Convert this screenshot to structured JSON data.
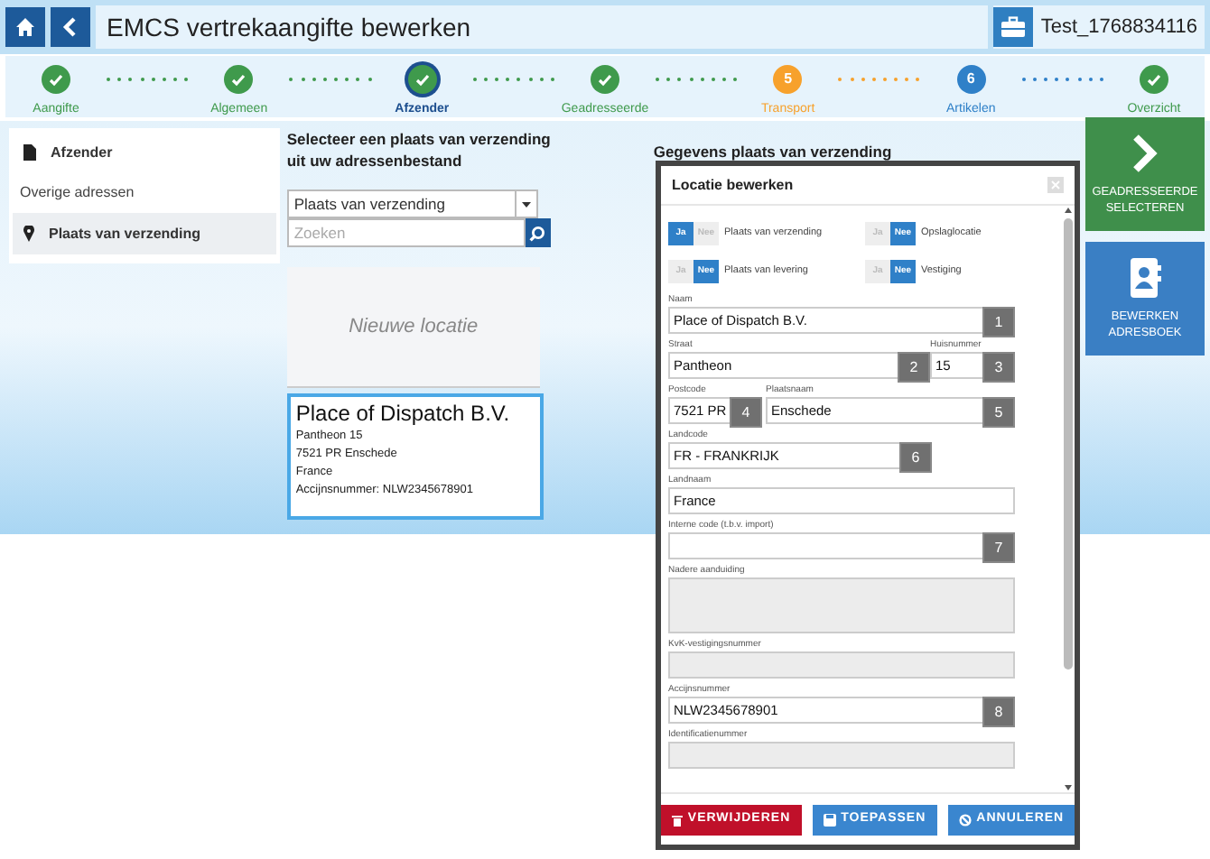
{
  "header": {
    "title": "EMCS vertrekaangifte bewerken",
    "user": "Test_1768834116"
  },
  "steps": [
    {
      "label": "Aangifte",
      "kind": "done",
      "selected": false
    },
    {
      "label": "Algemeen",
      "kind": "done",
      "selected": false
    },
    {
      "label": "Afzender",
      "kind": "done",
      "selected": true
    },
    {
      "label": "Geadresseerde",
      "kind": "done",
      "selected": false
    },
    {
      "label": "Transport",
      "kind": "warning",
      "number": "5",
      "selected": false
    },
    {
      "label": "Artikelen",
      "kind": "todo",
      "number": "6",
      "selected": false
    },
    {
      "label": "Overzicht",
      "kind": "done",
      "selected": false
    }
  ],
  "sidebar": {
    "items": [
      {
        "kind": "item",
        "label": "Afzender",
        "selected": false
      },
      {
        "kind": "heading",
        "label": "Overige adressen"
      },
      {
        "kind": "item",
        "label": "Plaats van verzending",
        "selected": true
      }
    ]
  },
  "picker": {
    "heading": "Selecteer een plaats van verzending uit uw adressenbestand",
    "select": "Plaats van verzending",
    "search_placeholder": "Zoeken",
    "new_card": "Nieuwe locatie",
    "address_card": {
      "selected": true,
      "name": "Place of Dispatch B.V.",
      "lines": [
        "Pantheon 15",
        "7521 PR Enschede",
        "France",
        "Accijnsnummer: NLW2345678901"
      ]
    }
  },
  "details_heading": "Gegevens plaats van verzending",
  "modal": {
    "title": "Locatie bewerken",
    "toggles": [
      {
        "label": "Plaats van verzending",
        "options": [
          {
            "label": "Ja",
            "selected": true
          },
          {
            "label": "Nee",
            "selected": false
          }
        ]
      },
      {
        "label": "Opslaglocatie",
        "options": [
          {
            "label": "Ja",
            "selected": false
          },
          {
            "label": "Nee",
            "selected": true
          }
        ]
      },
      {
        "label": "Plaats van levering",
        "options": [
          {
            "label": "Ja",
            "selected": false
          },
          {
            "label": "Nee",
            "selected": true
          }
        ]
      },
      {
        "label": "Vestiging",
        "options": [
          {
            "label": "Ja",
            "selected": false
          },
          {
            "label": "Nee",
            "selected": true
          }
        ]
      }
    ],
    "rows": [
      [
        {
          "label": "Naam",
          "value": "Place of Dispatch B.V.",
          "badge": "1",
          "disabled": false
        }
      ],
      [
        {
          "label": "Straat",
          "value": "Pantheon",
          "badge": "2",
          "disabled": false
        },
        {
          "label": "Huisnummer",
          "value": "15",
          "badge": "3",
          "disabled": false
        }
      ],
      [
        {
          "label": "Postcode",
          "value": "7521 PR",
          "badge": "4",
          "disabled": false
        },
        {
          "label": "Plaatsnaam",
          "value": "Enschede",
          "badge": "5",
          "disabled": false
        }
      ],
      [
        {
          "label": "Landcode",
          "value": "FR - FRANKRIJK",
          "badge": "6",
          "disabled": false
        }
      ],
      [
        {
          "label": "Landnaam",
          "value": "France",
          "disabled": false
        }
      ],
      [
        {
          "label": "Interne code (t.b.v. import)",
          "badge": "7",
          "disabled": false
        }
      ],
      [
        {
          "label": "Nadere aanduiding",
          "kind": "textarea",
          "disabled": true
        }
      ],
      [
        {
          "label": "KvK-vestigingsnummer",
          "disabled": true
        }
      ],
      [
        {
          "label": "Accijnsnummer",
          "value": "NLW2345678901",
          "badge": "8",
          "disabled": false
        }
      ],
      [
        {
          "label": "Identificatienummer",
          "disabled": true
        }
      ]
    ],
    "buttons": [
      {
        "label": "VERWIJDEREN",
        "kind": "danger"
      },
      {
        "label": "TOEPASSEN",
        "kind": "primary"
      },
      {
        "label": "ANNULEREN",
        "kind": "primary"
      }
    ]
  },
  "actions": [
    {
      "label": "GEADRESSEERDE SELECTEREN",
      "kind": "next"
    },
    {
      "label": "BEWERKEN ADRESBOEK",
      "kind": "addressbook"
    }
  ]
}
